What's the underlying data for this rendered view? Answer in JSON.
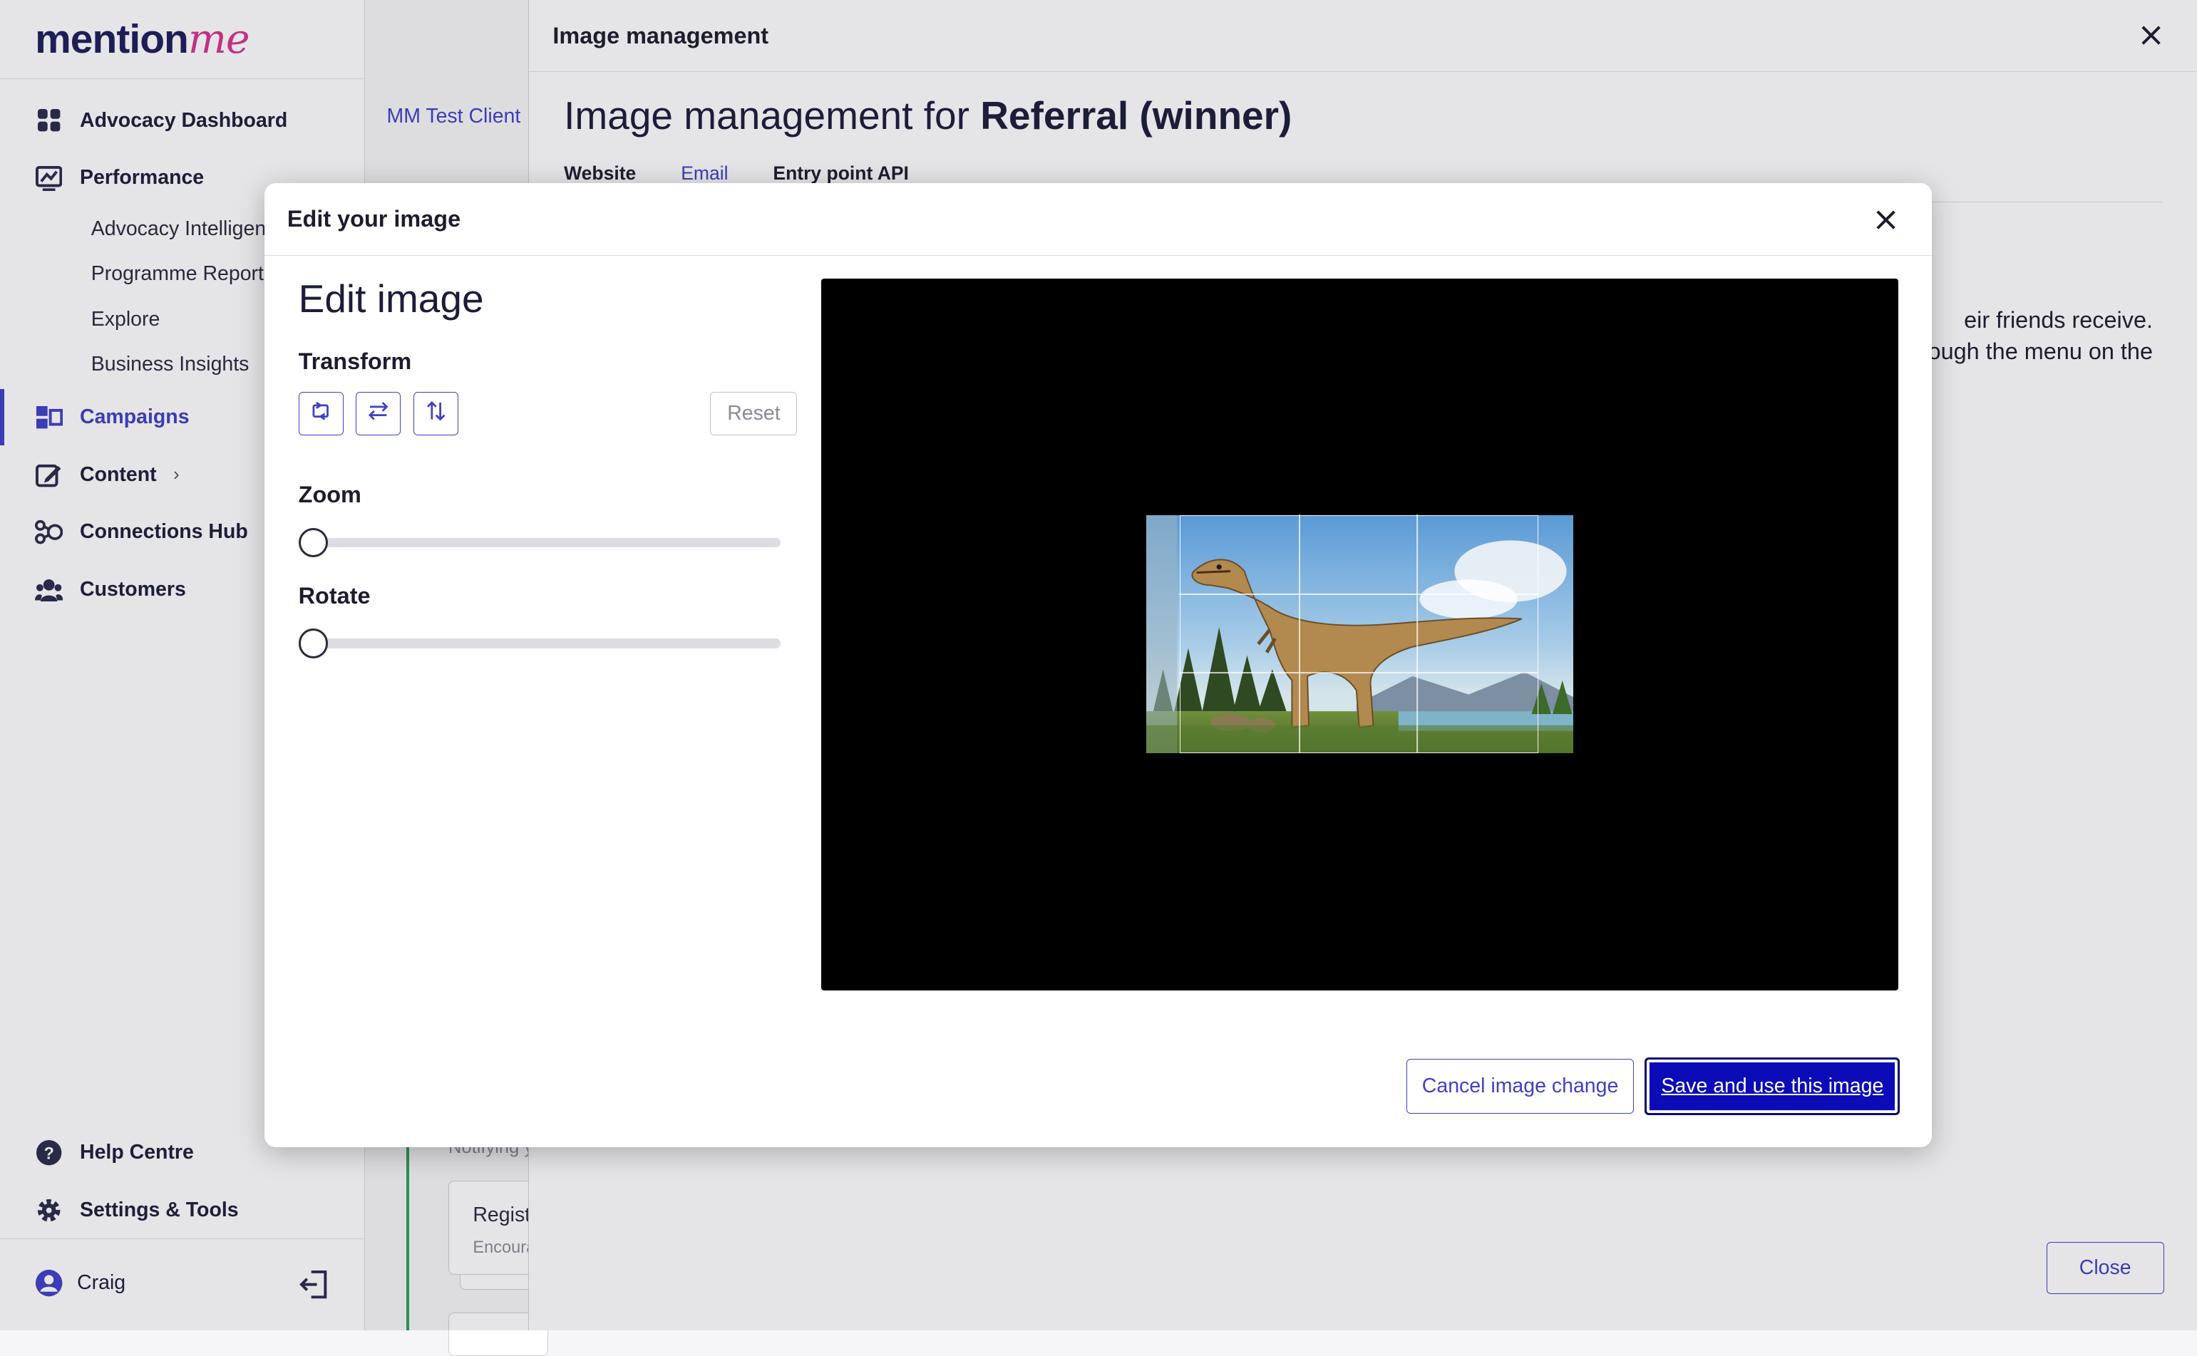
{
  "brand": {
    "logo_text_main": "mention",
    "logo_text_accent": "me",
    "accent": "#3f3fc8",
    "logo_accent_color": "#d6338c"
  },
  "sidebar": {
    "items": [
      {
        "label": "Advocacy Dashboard",
        "icon": "dashboard-grid-icon"
      },
      {
        "label": "Performance",
        "icon": "chart-line-icon"
      },
      {
        "label": "Campaigns",
        "icon": "campaigns-icon"
      },
      {
        "label": "Content",
        "icon": "edit-pencil-icon"
      },
      {
        "label": "Connections Hub",
        "icon": "connections-icon"
      },
      {
        "label": "Customers",
        "icon": "people-icon"
      }
    ],
    "sub_items": [
      "Advocacy Intelligen",
      "Programme Reporti",
      "Explore",
      "Business Insights"
    ],
    "help": "Help Centre",
    "settings": "Settings & Tools",
    "user": "Craig"
  },
  "background_page": {
    "breadcrumb": "MM Test Client",
    "notifying_text": "Notifying y",
    "card_title": "Regist",
    "card_sub": "Encoura"
  },
  "panel": {
    "header": "Image management",
    "title_prefix": "Image management for ",
    "title_bold": "Referral (winner)",
    "tabs": [
      "Website",
      "Email",
      "Entry point API"
    ],
    "desc_line1": "eir friends receive.",
    "desc_line2": "ough the menu on the",
    "close_label": "Close"
  },
  "modal": {
    "header": "Edit your image",
    "title": "Edit image",
    "transform_label": "Transform",
    "reset_label": "Reset",
    "zoom_label": "Zoom",
    "zoom_value": 0,
    "rotate_label": "Rotate",
    "rotate_value": 0,
    "cancel_label": "Cancel image change",
    "save_label": "Save and use this image"
  }
}
